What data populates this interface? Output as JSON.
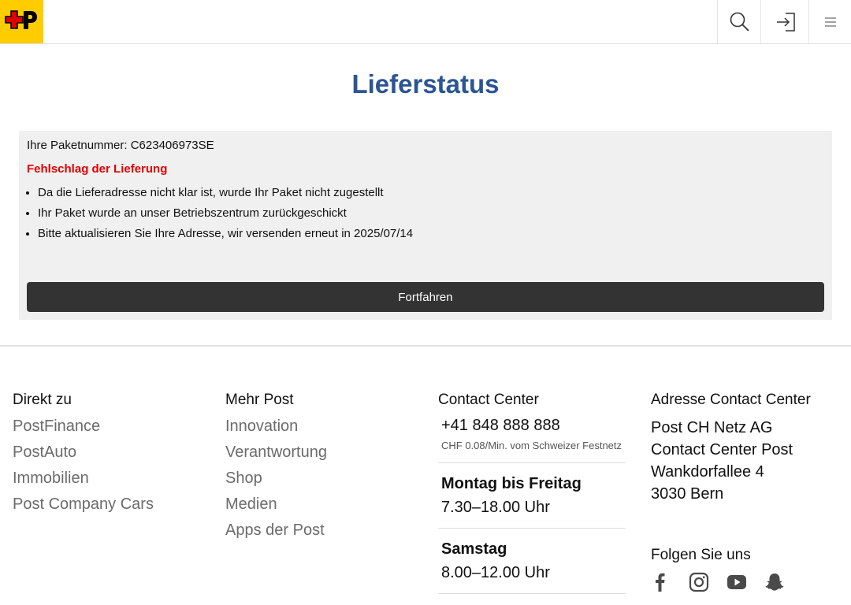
{
  "header": {
    "logo_icon": "swiss-post-logo",
    "brand_color": "#ffcc00",
    "icons": [
      "search-icon",
      "login-icon",
      "menu-icon"
    ]
  },
  "page": {
    "title": "Lieferstatus",
    "title_color": "#2b5593"
  },
  "status": {
    "package_label": "Ihre Paketnummer: C623406973SE",
    "failure": "Fehlschlag der Lieferung",
    "failure_color": "#e00000",
    "reasons": [
      "Da die Lieferadresse nicht klar ist, wurde Ihr Paket nicht zugestellt",
      "Ihr Paket wurde an unser Betriebszentrum zurückgeschickt",
      "Bitte aktualisieren Sie Ihre Adresse, wir versenden erneut in 2025/07/14"
    ],
    "button_label": "Fortfahren"
  },
  "footer": {
    "direkt": {
      "heading": "Direkt zu",
      "links": [
        "PostFinance",
        "PostAuto",
        "Immobilien",
        "Post Company Cars"
      ]
    },
    "mehr": {
      "heading": "Mehr Post",
      "links": [
        "Innovation",
        "Verantwortung",
        "Shop",
        "Medien",
        "Apps der Post"
      ]
    },
    "contact": {
      "heading": "Contact Center",
      "phone": "+41 848 888 888",
      "rate": "CHF 0.08/Min. vom Schweizer Festnetz",
      "weekday": "Montag bis Freitag",
      "weekday_hours": "7.30–18.00 Uhr",
      "saturday": "Samstag",
      "saturday_hours": "8.00–12.00 Uhr"
    },
    "address": {
      "heading": "Adresse Contact Center",
      "lines": [
        "Post CH Netz AG",
        "Contact Center Post",
        "Wankdorfallee 4",
        "3030 Bern"
      ],
      "follow_heading": "Folgen Sie uns",
      "social_icons": [
        "facebook-icon",
        "instagram-icon",
        "youtube-icon",
        "snapchat-icon"
      ]
    }
  }
}
